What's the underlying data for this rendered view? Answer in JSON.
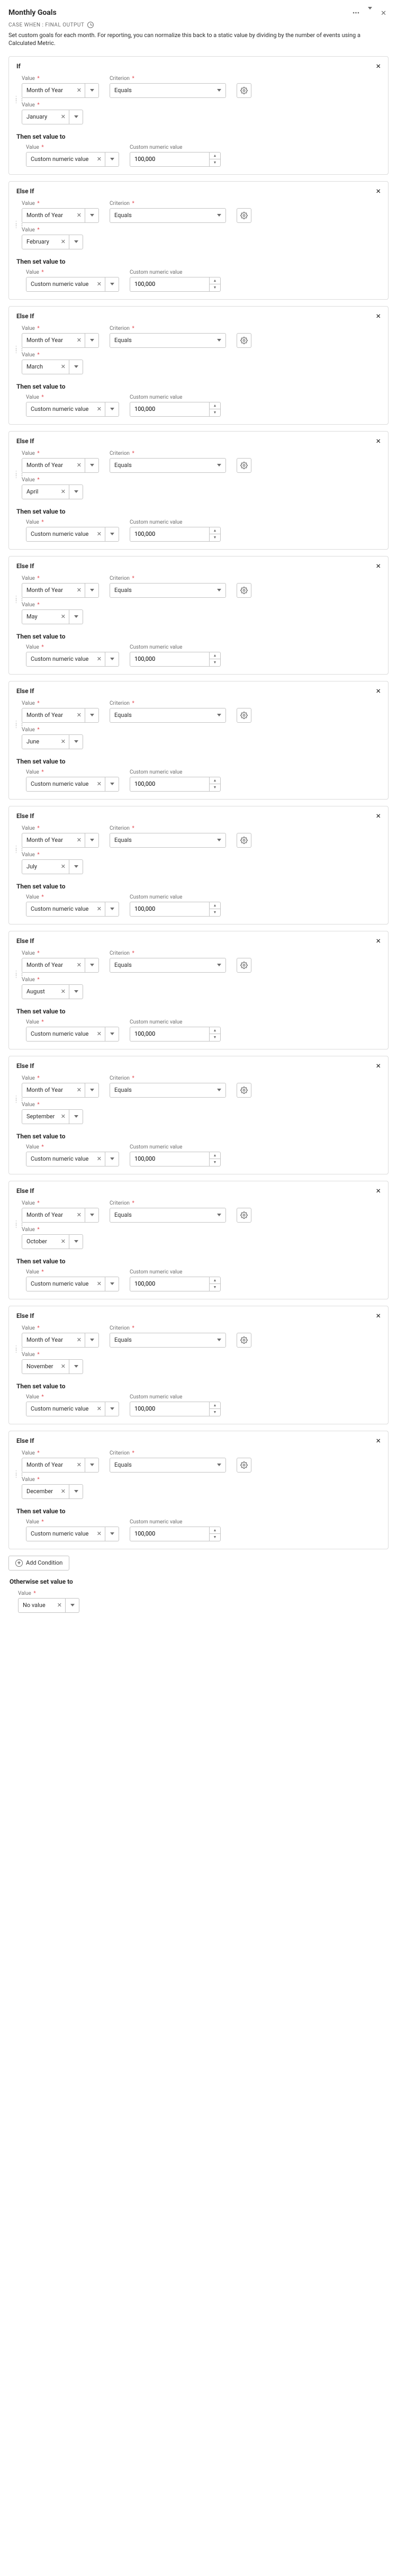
{
  "header": {
    "title": "Monthly Goals",
    "subheader": "CASE WHEN : FINAL OUTPUT",
    "description": "Set custom goals for each month. For reporting, you can normalize this back to a static value by dividing by the number of events using a Calculated Metric."
  },
  "labels": {
    "if": "If",
    "elseif": "Else If",
    "value": "Value",
    "criterion": "Criterion",
    "then": "Then set value to",
    "custom_numeric": "Custom numeric value",
    "month_of_year": "Month of Year",
    "add_condition": "Add Condition",
    "otherwise": "Otherwise set value to",
    "no_value": "No value"
  },
  "criterion_value": "Equals",
  "custom_numeric_option": "Custom numeric value",
  "default_goal": "100,000",
  "conditions": [
    {
      "type": "If",
      "month": "January",
      "goal": "100,000"
    },
    {
      "type": "Else If",
      "month": "February",
      "goal": "100,000"
    },
    {
      "type": "Else If",
      "month": "March",
      "goal": "100,000"
    },
    {
      "type": "Else If",
      "month": "April",
      "goal": "100,000"
    },
    {
      "type": "Else If",
      "month": "May",
      "goal": "100,000"
    },
    {
      "type": "Else If",
      "month": "June",
      "goal": "100,000"
    },
    {
      "type": "Else If",
      "month": "July",
      "goal": "100,000"
    },
    {
      "type": "Else If",
      "month": "August",
      "goal": "100,000"
    },
    {
      "type": "Else If",
      "month": "September",
      "goal": "100,000"
    },
    {
      "type": "Else If",
      "month": "October",
      "goal": "100,000"
    },
    {
      "type": "Else If",
      "month": "November",
      "goal": "100,000"
    },
    {
      "type": "Else If",
      "month": "December",
      "goal": "100,000"
    }
  ]
}
